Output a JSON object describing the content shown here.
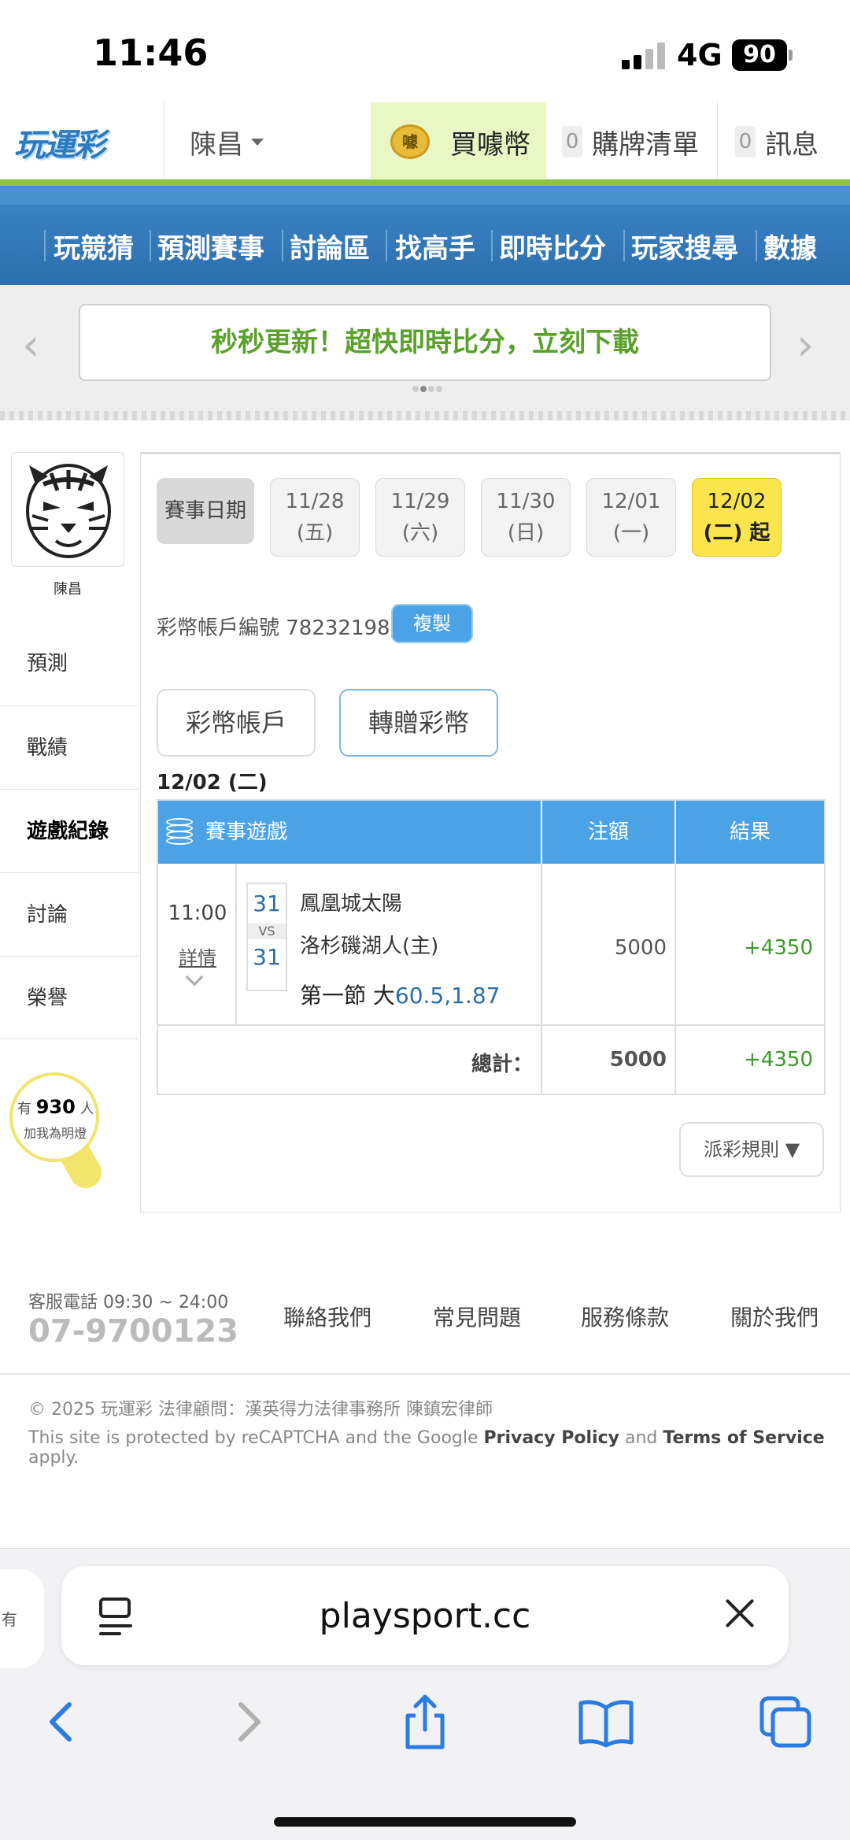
{
  "status_bar": {
    "time": "11:46",
    "network": "4G",
    "battery": "90"
  },
  "header": {
    "logo": "玩運彩",
    "user_name": "陳昌",
    "buy_coin_label": "買噱幣",
    "coin_icon_text": "噱",
    "cart_count": "0",
    "cart_label": "購牌清單",
    "messages_count": "0",
    "messages_label": "訊息"
  },
  "nav": {
    "items": [
      "玩競猜",
      "預測賽事",
      "討論區",
      "找高手",
      "即時比分",
      "玩家搜尋",
      "數據"
    ]
  },
  "banner": {
    "text": "秒秒更新！超快即時比分，立刻下載"
  },
  "sidebar": {
    "user_name": "陳昌",
    "menu": [
      "預測",
      "戰績",
      "遊戲紀錄",
      "討論",
      "榮譽"
    ],
    "active": "遊戲紀錄",
    "fans_prefix": "有",
    "fans_count": "930",
    "fans_suffix": "人",
    "fans_text": "加我為明燈"
  },
  "content": {
    "date_label": "賽事日期",
    "dates": [
      {
        "date": "11/28",
        "day": "(五)"
      },
      {
        "date": "11/29",
        "day": "(六)"
      },
      {
        "date": "11/30",
        "day": "(日)"
      },
      {
        "date": "12/01",
        "day": "(一)"
      },
      {
        "date": "12/02",
        "day": "(二) 起"
      }
    ],
    "account_label": "彩幣帳戶編號 78232198",
    "copy_button": "複製",
    "tabs": [
      "彩幣帳戶",
      "轉贈彩幣"
    ],
    "day_title": "12/02 (二)",
    "table": {
      "headers": [
        "賽事遊戲",
        "注額",
        "結果"
      ],
      "rows": [
        {
          "time": "11:00",
          "detail": "詳情",
          "score_away": "31",
          "vs": "VS",
          "score_home": "31",
          "team_away": "鳳凰城太陽",
          "team_home": "洛杉磯湖人(主)",
          "period_label": "第一節 大",
          "odds": "60.5,1.87",
          "bet": "5000",
          "result": "+4350"
        }
      ],
      "total_label": "總計：",
      "total_bet": "5000",
      "total_result": "+4350"
    },
    "rules_button": "派彩規則 ▼"
  },
  "footer": {
    "service_label": "客服電話 09:30 ~ 24:00",
    "service_phone": "07-9700123",
    "links": [
      "聯絡我們",
      "常見問題",
      "服務條款",
      "關於我們"
    ],
    "copyright": "© 2025 玩運彩 法律顧問：漢英得力法律事務所 陳鎮宏律師",
    "captcha_pre": "This site is protected by reCAPTCHA and the Google",
    "privacy": "Privacy Policy",
    "and": "and",
    "terms": "Terms of Service",
    "apply": "apply."
  },
  "browser": {
    "url": "playsport.cc",
    "prev_tab_text": "有"
  },
  "colors": {
    "accent_blue": "#4ba3e6",
    "win_green": "#3b9a2a",
    "highlight_yellow": "#fbe54d",
    "nav_green": "#8cc63f"
  }
}
